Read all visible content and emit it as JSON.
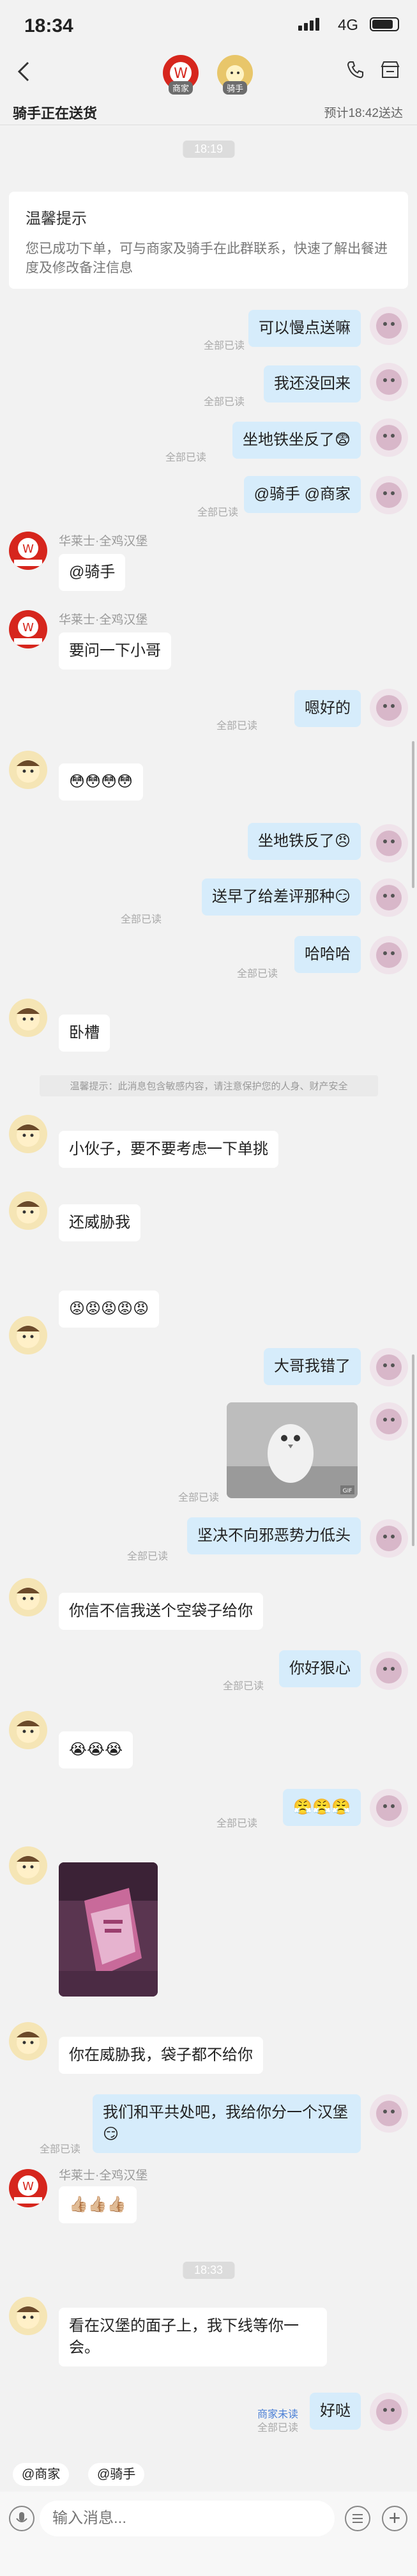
{
  "status": {
    "time": "18:34",
    "network": "4G"
  },
  "header": {
    "merchant_tag": "商家",
    "rider_tag": "骑手",
    "delivery_status": "骑手正在送货",
    "eta": "预计18:42送达"
  },
  "times": [
    "18:19",
    "18:33"
  ],
  "notice": {
    "title": "温馨提示",
    "body": "您已成功下单，可与商家及骑手在此群联系，快速了解出餐进度及修改备注信息"
  },
  "system_note": "温馨提示：此消息包含敏感内容，请注意保护您的人身、财产安全",
  "merchant_name": "华莱士·全鸡汉堡",
  "read_label": "全部已读",
  "unread_label": "商家未读",
  "messages": [
    "可以慢点送嘛",
    "我还没回来",
    "坐地铁坐反了😨",
    "@骑手 @商家",
    "@骑手",
    "要问一下小哥",
    "嗯好的",
    "😳😳😳😳",
    "坐地铁反了😠",
    "送早了给差评那种😏",
    "哈哈哈",
    "卧槽",
    "小伙子，要不要考虑一下单挑",
    "还威胁我",
    "😡😡😡😡😡",
    "大哥我错了",
    "坚决不向邪恶势力低头",
    "你信不信我送个空袋子给你",
    "你好狠心",
    "😭😭😭",
    "😤😤😤",
    "你在威胁我，袋子都不给你",
    "我们和平共处吧，我给你分一个汉堡😏",
    "👍🏼👍🏼👍🏼",
    "看在汉堡的面子上，我下线等你一会。",
    "好哒"
  ],
  "chips": [
    "@商家",
    "@骑手"
  ],
  "input": {
    "placeholder": "输入消息..."
  },
  "watermark": "GIF"
}
